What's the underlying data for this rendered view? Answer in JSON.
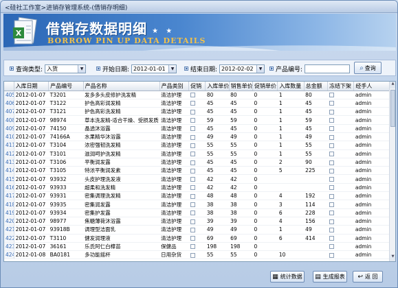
{
  "window": {
    "title": "<硅社工作室>进销存管理系统-(借销存明细)"
  },
  "banner": {
    "title_cn": "借销存数据明细",
    "title_en": "BORROW PIN UP DATA DETAILS",
    "stars": "★ ★ ★"
  },
  "toolbar": {
    "query_type_label": "查询类型:",
    "query_type_value": "入货",
    "start_date_label": "开始日期:",
    "start_date_value": "2012-01-01",
    "end_date_label": "结束日期:",
    "end_date_value": "2012-02-02",
    "product_code_label": "产品编号:",
    "product_code_value": "",
    "query_button": "查询"
  },
  "table": {
    "columns": [
      "入库日期",
      "产品编号",
      "产品名称",
      "产品类别",
      "促销",
      "入库单价",
      "销售单价",
      "促销单价",
      "入库数量",
      "总金额",
      "冻结下架",
      "经手人"
    ],
    "rows": [
      [
        "405",
        "2012-01-07",
        "T3201",
        "发多多头皮修护洗发精",
        "清洁护理",
        "",
        "80",
        "80",
        "0",
        "1",
        "80",
        "",
        "admin"
      ],
      [
        "406",
        "2012-01-07",
        "T3122",
        "护色高彩润发精",
        "清洁护理",
        "",
        "45",
        "45",
        "0",
        "1",
        "45",
        "",
        "admin"
      ],
      [
        "407",
        "2012-01-07",
        "T3121",
        "护色高彩洗发精",
        "清洁护理",
        "",
        "45",
        "45",
        "0",
        "1",
        "45",
        "",
        "admin"
      ],
      [
        "408",
        "2012-01-07",
        "98974",
        "草本洗发精-适合干燥、受损发质",
        "清洁护理",
        "",
        "59",
        "59",
        "0",
        "1",
        "59",
        "",
        "admin"
      ],
      [
        "409",
        "2012-01-07",
        "74150",
        "晶透沐浴露",
        "清洁护理",
        "",
        "45",
        "45",
        "0",
        "1",
        "45",
        "",
        "admin"
      ],
      [
        "410",
        "2012-01-07",
        "74166A",
        "水果精华沐浴露",
        "清洁护理",
        "",
        "49",
        "49",
        "0",
        "1",
        "49",
        "",
        "admin"
      ],
      [
        "411",
        "2012-01-07",
        "T3104",
        "浓密强韧洗发精",
        "清洁护理",
        "",
        "55",
        "55",
        "0",
        "1",
        "55",
        "",
        "admin"
      ],
      [
        "412",
        "2012-01-07",
        "T3101",
        "滋润呵护洗发精",
        "清洁护理",
        "",
        "55",
        "55",
        "0",
        "1",
        "55",
        "",
        "admin"
      ],
      [
        "413",
        "2012-01-07",
        "T3106",
        "平衡润发露",
        "清洁护理",
        "",
        "45",
        "45",
        "0",
        "2",
        "90",
        "",
        "admin"
      ],
      [
        "414",
        "2012-01-07",
        "T3105",
        "特浓平衡润发素",
        "清洁护理",
        "",
        "45",
        "45",
        "0",
        "5",
        "225",
        "",
        "admin"
      ],
      [
        "415",
        "2012-01-07",
        "93932",
        "头皮护理洗发液",
        "清洁护理",
        "",
        "42",
        "42",
        "0",
        "",
        "",
        "",
        "admin"
      ],
      [
        "416",
        "2012-01-07",
        "93933",
        "超柔和洗发精",
        "清洁护理",
        "",
        "42",
        "42",
        "0",
        "",
        "",
        "",
        "admin"
      ],
      [
        "417",
        "2012-01-07",
        "93931",
        "密集调理洗发精",
        "清洁护理",
        "",
        "48",
        "48",
        "0",
        "4",
        "192",
        "",
        "admin"
      ],
      [
        "418",
        "2012-01-07",
        "93935",
        "密集润发露",
        "清洁护理",
        "",
        "38",
        "38",
        "0",
        "3",
        "114",
        "",
        "admin"
      ],
      [
        "419",
        "2012-01-07",
        "93934",
        "密集护发露",
        "清洁护理",
        "",
        "38",
        "38",
        "0",
        "6",
        "228",
        "",
        "admin"
      ],
      [
        "420",
        "2012-01-07",
        "98977",
        "焦糖薄荷沐浴露",
        "清洁护理",
        "",
        "39",
        "39",
        "0",
        "4",
        "156",
        "",
        "admin"
      ],
      [
        "421",
        "2012-01-07",
        "93918B",
        "调理型洁面乳",
        "清洁护理",
        "",
        "49",
        "49",
        "0",
        "1",
        "49",
        "",
        "admin"
      ],
      [
        "422",
        "2012-01-07",
        "T3110",
        "健发润理液",
        "清洁护理",
        "",
        "69",
        "69",
        "0",
        "6",
        "414",
        "",
        "admin"
      ],
      [
        "423",
        "2012-01-07",
        "36161",
        "乐氏阿仁白樟苗",
        "保健品",
        "",
        "198",
        "198",
        "0",
        "",
        "",
        "",
        "admin"
      ],
      [
        "424",
        "2012-01-08",
        "BA0181",
        "多功能摇杯",
        "日用杂货",
        "",
        "55",
        "55",
        "0",
        "10",
        "",
        "",
        "admin"
      ]
    ]
  },
  "footer": {
    "stats_button": "统计数据",
    "report_button": "生成报表",
    "back_button": "返  回"
  }
}
